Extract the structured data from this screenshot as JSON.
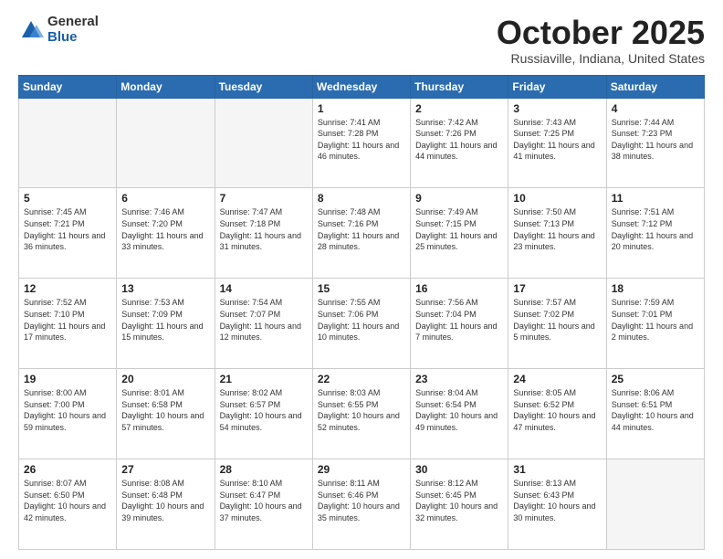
{
  "logo": {
    "general": "General",
    "blue": "Blue"
  },
  "header": {
    "month": "October 2025",
    "location": "Russiaville, Indiana, United States"
  },
  "weekdays": [
    "Sunday",
    "Monday",
    "Tuesday",
    "Wednesday",
    "Thursday",
    "Friday",
    "Saturday"
  ],
  "weeks": [
    [
      {
        "day": "",
        "info": ""
      },
      {
        "day": "",
        "info": ""
      },
      {
        "day": "",
        "info": ""
      },
      {
        "day": "1",
        "info": "Sunrise: 7:41 AM\nSunset: 7:28 PM\nDaylight: 11 hours\nand 46 minutes."
      },
      {
        "day": "2",
        "info": "Sunrise: 7:42 AM\nSunset: 7:26 PM\nDaylight: 11 hours\nand 44 minutes."
      },
      {
        "day": "3",
        "info": "Sunrise: 7:43 AM\nSunset: 7:25 PM\nDaylight: 11 hours\nand 41 minutes."
      },
      {
        "day": "4",
        "info": "Sunrise: 7:44 AM\nSunset: 7:23 PM\nDaylight: 11 hours\nand 38 minutes."
      }
    ],
    [
      {
        "day": "5",
        "info": "Sunrise: 7:45 AM\nSunset: 7:21 PM\nDaylight: 11 hours\nand 36 minutes."
      },
      {
        "day": "6",
        "info": "Sunrise: 7:46 AM\nSunset: 7:20 PM\nDaylight: 11 hours\nand 33 minutes."
      },
      {
        "day": "7",
        "info": "Sunrise: 7:47 AM\nSunset: 7:18 PM\nDaylight: 11 hours\nand 31 minutes."
      },
      {
        "day": "8",
        "info": "Sunrise: 7:48 AM\nSunset: 7:16 PM\nDaylight: 11 hours\nand 28 minutes."
      },
      {
        "day": "9",
        "info": "Sunrise: 7:49 AM\nSunset: 7:15 PM\nDaylight: 11 hours\nand 25 minutes."
      },
      {
        "day": "10",
        "info": "Sunrise: 7:50 AM\nSunset: 7:13 PM\nDaylight: 11 hours\nand 23 minutes."
      },
      {
        "day": "11",
        "info": "Sunrise: 7:51 AM\nSunset: 7:12 PM\nDaylight: 11 hours\nand 20 minutes."
      }
    ],
    [
      {
        "day": "12",
        "info": "Sunrise: 7:52 AM\nSunset: 7:10 PM\nDaylight: 11 hours\nand 17 minutes."
      },
      {
        "day": "13",
        "info": "Sunrise: 7:53 AM\nSunset: 7:09 PM\nDaylight: 11 hours\nand 15 minutes."
      },
      {
        "day": "14",
        "info": "Sunrise: 7:54 AM\nSunset: 7:07 PM\nDaylight: 11 hours\nand 12 minutes."
      },
      {
        "day": "15",
        "info": "Sunrise: 7:55 AM\nSunset: 7:06 PM\nDaylight: 11 hours\nand 10 minutes."
      },
      {
        "day": "16",
        "info": "Sunrise: 7:56 AM\nSunset: 7:04 PM\nDaylight: 11 hours\nand 7 minutes."
      },
      {
        "day": "17",
        "info": "Sunrise: 7:57 AM\nSunset: 7:02 PM\nDaylight: 11 hours\nand 5 minutes."
      },
      {
        "day": "18",
        "info": "Sunrise: 7:59 AM\nSunset: 7:01 PM\nDaylight: 11 hours\nand 2 minutes."
      }
    ],
    [
      {
        "day": "19",
        "info": "Sunrise: 8:00 AM\nSunset: 7:00 PM\nDaylight: 10 hours\nand 59 minutes."
      },
      {
        "day": "20",
        "info": "Sunrise: 8:01 AM\nSunset: 6:58 PM\nDaylight: 10 hours\nand 57 minutes."
      },
      {
        "day": "21",
        "info": "Sunrise: 8:02 AM\nSunset: 6:57 PM\nDaylight: 10 hours\nand 54 minutes."
      },
      {
        "day": "22",
        "info": "Sunrise: 8:03 AM\nSunset: 6:55 PM\nDaylight: 10 hours\nand 52 minutes."
      },
      {
        "day": "23",
        "info": "Sunrise: 8:04 AM\nSunset: 6:54 PM\nDaylight: 10 hours\nand 49 minutes."
      },
      {
        "day": "24",
        "info": "Sunrise: 8:05 AM\nSunset: 6:52 PM\nDaylight: 10 hours\nand 47 minutes."
      },
      {
        "day": "25",
        "info": "Sunrise: 8:06 AM\nSunset: 6:51 PM\nDaylight: 10 hours\nand 44 minutes."
      }
    ],
    [
      {
        "day": "26",
        "info": "Sunrise: 8:07 AM\nSunset: 6:50 PM\nDaylight: 10 hours\nand 42 minutes."
      },
      {
        "day": "27",
        "info": "Sunrise: 8:08 AM\nSunset: 6:48 PM\nDaylight: 10 hours\nand 39 minutes."
      },
      {
        "day": "28",
        "info": "Sunrise: 8:10 AM\nSunset: 6:47 PM\nDaylight: 10 hours\nand 37 minutes."
      },
      {
        "day": "29",
        "info": "Sunrise: 8:11 AM\nSunset: 6:46 PM\nDaylight: 10 hours\nand 35 minutes."
      },
      {
        "day": "30",
        "info": "Sunrise: 8:12 AM\nSunset: 6:45 PM\nDaylight: 10 hours\nand 32 minutes."
      },
      {
        "day": "31",
        "info": "Sunrise: 8:13 AM\nSunset: 6:43 PM\nDaylight: 10 hours\nand 30 minutes."
      },
      {
        "day": "",
        "info": ""
      }
    ]
  ]
}
